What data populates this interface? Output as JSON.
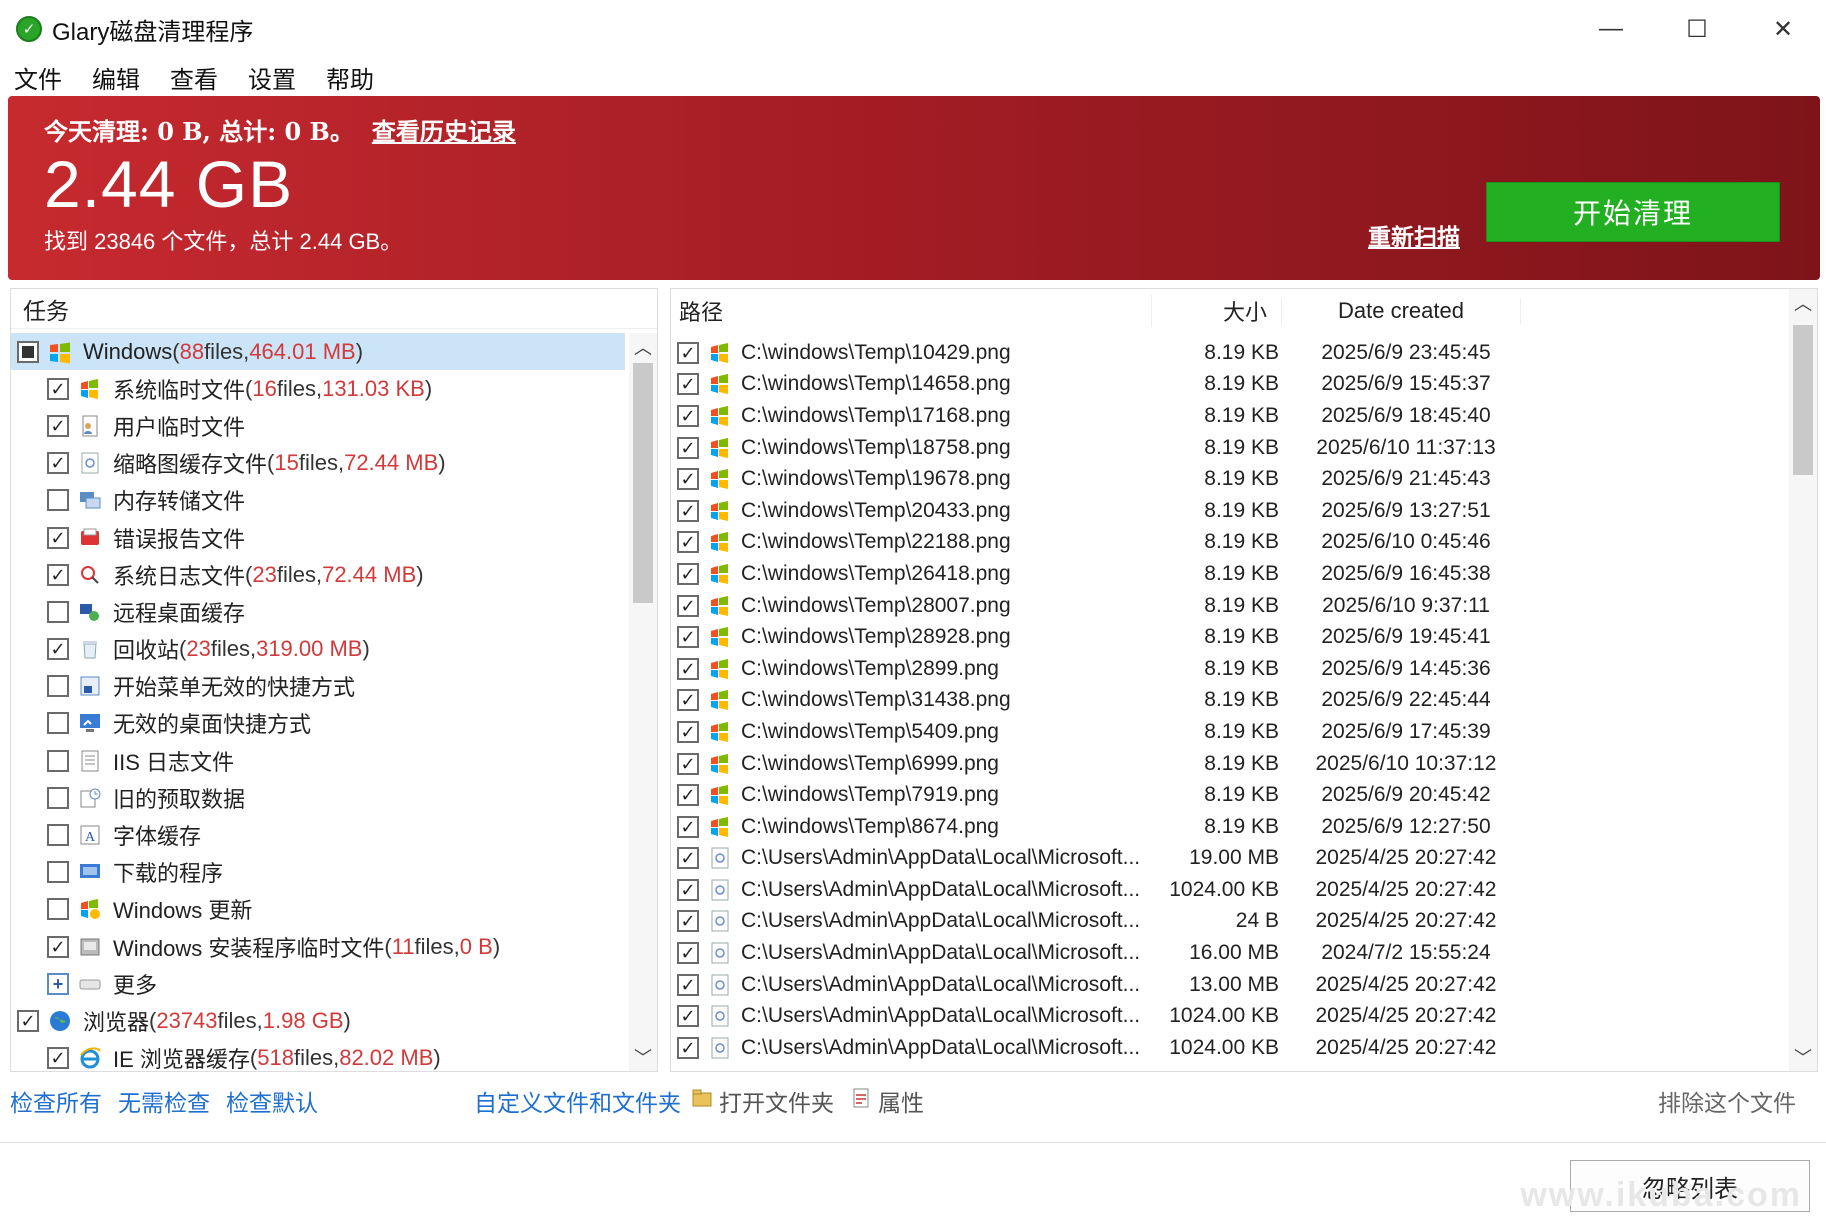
{
  "window": {
    "title": "Glary磁盘清理程序",
    "minimize": "—",
    "maximize": "☐",
    "close": "✕"
  },
  "menu": [
    "文件",
    "编辑",
    "查看",
    "设置",
    "帮助"
  ],
  "banner": {
    "summary": "今天清理: 0 B, 总计: 0 B。",
    "history_link": "查看历史记录",
    "total_size": "2.44 GB",
    "found_text": "找到 23846 个文件，总计 2.44 GB。",
    "rescan": "重新扫描",
    "start_button": "开始清理"
  },
  "left_panel": {
    "header": "任务",
    "tasks": [
      {
        "label": "Windows",
        "open": " (",
        "count": "88",
        "mid": " files, ",
        "size": "464.01 MB",
        "close": ")",
        "check": "partial",
        "level": 0,
        "icon": "windows-icon",
        "selected": true
      },
      {
        "label": "系统临时文件",
        "open": " (",
        "count": "16",
        "mid": " files, ",
        "size": "131.03 KB",
        "close": ")",
        "check": "checked",
        "level": 1,
        "icon": "windows-flag-icon"
      },
      {
        "label": "用户临时文件",
        "open": "",
        "count": "",
        "mid": "",
        "size": "",
        "close": "",
        "check": "checked",
        "level": 1,
        "icon": "user-temp-icon"
      },
      {
        "label": "缩略图缓存文件",
        "open": " (",
        "count": "15",
        "mid": " files, ",
        "size": "72.44 MB",
        "close": ")",
        "check": "checked",
        "level": 1,
        "icon": "thumbnail-icon"
      },
      {
        "label": "内存转储文件",
        "open": "",
        "count": "",
        "mid": "",
        "size": "",
        "close": "",
        "check": "unchecked",
        "level": 1,
        "icon": "memory-dump-icon"
      },
      {
        "label": "错误报告文件",
        "open": "",
        "count": "",
        "mid": "",
        "size": "",
        "close": "",
        "check": "checked",
        "level": 1,
        "icon": "error-report-icon"
      },
      {
        "label": "系统日志文件",
        "open": " (",
        "count": "23",
        "mid": " files, ",
        "size": "72.44 MB",
        "close": ")",
        "check": "checked",
        "level": 1,
        "icon": "system-log-icon"
      },
      {
        "label": "远程桌面缓存",
        "open": "",
        "count": "",
        "mid": "",
        "size": "",
        "close": "",
        "check": "unchecked",
        "level": 1,
        "icon": "remote-desktop-icon"
      },
      {
        "label": "回收站",
        "open": " (",
        "count": "23",
        "mid": " files, ",
        "size": "319.00 MB",
        "close": ")",
        "check": "checked",
        "level": 1,
        "icon": "recycle-bin-icon"
      },
      {
        "label": "开始菜单无效的快捷方式",
        "open": "",
        "count": "",
        "mid": "",
        "size": "",
        "close": "",
        "check": "unchecked",
        "level": 1,
        "icon": "start-menu-shortcut-icon"
      },
      {
        "label": "无效的桌面快捷方式",
        "open": "",
        "count": "",
        "mid": "",
        "size": "",
        "close": "",
        "check": "unchecked",
        "level": 1,
        "icon": "desktop-shortcut-icon"
      },
      {
        "label": "IIS 日志文件",
        "open": "",
        "count": "",
        "mid": "",
        "size": "",
        "close": "",
        "check": "unchecked",
        "level": 1,
        "icon": "iis-log-icon"
      },
      {
        "label": "旧的预取数据",
        "open": "",
        "count": "",
        "mid": "",
        "size": "",
        "close": "",
        "check": "unchecked",
        "level": 1,
        "icon": "prefetch-icon"
      },
      {
        "label": "字体缓存",
        "open": "",
        "count": "",
        "mid": "",
        "size": "",
        "close": "",
        "check": "unchecked",
        "level": 1,
        "icon": "font-cache-icon"
      },
      {
        "label": "下载的程序",
        "open": "",
        "count": "",
        "mid": "",
        "size": "",
        "close": "",
        "check": "unchecked",
        "level": 1,
        "icon": "downloaded-program-icon"
      },
      {
        "label": "Windows 更新",
        "open": "",
        "count": "",
        "mid": "",
        "size": "",
        "close": "",
        "check": "unchecked",
        "level": 1,
        "icon": "windows-update-icon"
      },
      {
        "label": "Windows 安装程序临时文件",
        "open": " (",
        "count": "11",
        "mid": " files, ",
        "size": "0 B",
        "close": ")",
        "check": "checked",
        "level": 1,
        "icon": "installer-temp-icon"
      },
      {
        "label": "更多",
        "open": "",
        "count": "",
        "mid": "",
        "size": "",
        "close": "",
        "check": "expand",
        "level": 1,
        "icon": "more-drive-icon"
      },
      {
        "label": "浏览器",
        "open": " (",
        "count": "23743",
        "mid": " files, ",
        "size": "1.98 GB",
        "close": ")",
        "check": "checked",
        "level": 0,
        "icon": "globe-icon"
      },
      {
        "label": "IE 浏览器缓存",
        "open": " (",
        "count": "518",
        "mid": " files, ",
        "size": "82.02 MB",
        "close": ")",
        "check": "checked",
        "level": 1,
        "icon": "ie-icon"
      }
    ]
  },
  "right_panel": {
    "columns": {
      "path": "路径",
      "size": "大小",
      "date": "Date created"
    },
    "files": [
      {
        "path": "C:\\windows\\Temp\\10429.png",
        "size": "8.19 KB",
        "date": "2025/6/9 23:45:45",
        "icon": "windows-flag-icon"
      },
      {
        "path": "C:\\windows\\Temp\\14658.png",
        "size": "8.19 KB",
        "date": "2025/6/9 15:45:37",
        "icon": "windows-flag-icon"
      },
      {
        "path": "C:\\windows\\Temp\\17168.png",
        "size": "8.19 KB",
        "date": "2025/6/9 18:45:40",
        "icon": "windows-flag-icon"
      },
      {
        "path": "C:\\windows\\Temp\\18758.png",
        "size": "8.19 KB",
        "date": "2025/6/10 11:37:13",
        "icon": "windows-flag-icon"
      },
      {
        "path": "C:\\windows\\Temp\\19678.png",
        "size": "8.19 KB",
        "date": "2025/6/9 21:45:43",
        "icon": "windows-flag-icon"
      },
      {
        "path": "C:\\windows\\Temp\\20433.png",
        "size": "8.19 KB",
        "date": "2025/6/9 13:27:51",
        "icon": "windows-flag-icon"
      },
      {
        "path": "C:\\windows\\Temp\\22188.png",
        "size": "8.19 KB",
        "date": "2025/6/10 0:45:46",
        "icon": "windows-flag-icon"
      },
      {
        "path": "C:\\windows\\Temp\\26418.png",
        "size": "8.19 KB",
        "date": "2025/6/9 16:45:38",
        "icon": "windows-flag-icon"
      },
      {
        "path": "C:\\windows\\Temp\\28007.png",
        "size": "8.19 KB",
        "date": "2025/6/10 9:37:11",
        "icon": "windows-flag-icon"
      },
      {
        "path": "C:\\windows\\Temp\\28928.png",
        "size": "8.19 KB",
        "date": "2025/6/9 19:45:41",
        "icon": "windows-flag-icon"
      },
      {
        "path": "C:\\windows\\Temp\\2899.png",
        "size": "8.19 KB",
        "date": "2025/6/9 14:45:36",
        "icon": "windows-flag-icon"
      },
      {
        "path": "C:\\windows\\Temp\\31438.png",
        "size": "8.19 KB",
        "date": "2025/6/9 22:45:44",
        "icon": "windows-flag-icon"
      },
      {
        "path": "C:\\windows\\Temp\\5409.png",
        "size": "8.19 KB",
        "date": "2025/6/9 17:45:39",
        "icon": "windows-flag-icon"
      },
      {
        "path": "C:\\windows\\Temp\\6999.png",
        "size": "8.19 KB",
        "date": "2025/6/10 10:37:12",
        "icon": "windows-flag-icon"
      },
      {
        "path": "C:\\windows\\Temp\\7919.png",
        "size": "8.19 KB",
        "date": "2025/6/9 20:45:42",
        "icon": "windows-flag-icon"
      },
      {
        "path": "C:\\windows\\Temp\\8674.png",
        "size": "8.19 KB",
        "date": "2025/6/9 12:27:50",
        "icon": "windows-flag-icon"
      },
      {
        "path": "C:\\Users\\Admin\\AppData\\Local\\Microsoft...",
        "size": "19.00 MB",
        "date": "2025/4/25 20:27:42",
        "icon": "thumbnail-icon"
      },
      {
        "path": "C:\\Users\\Admin\\AppData\\Local\\Microsoft...",
        "size": "1024.00 KB",
        "date": "2025/4/25 20:27:42",
        "icon": "thumbnail-icon"
      },
      {
        "path": "C:\\Users\\Admin\\AppData\\Local\\Microsoft...",
        "size": "24 B",
        "date": "2025/4/25 20:27:42",
        "icon": "thumbnail-icon"
      },
      {
        "path": "C:\\Users\\Admin\\AppData\\Local\\Microsoft...",
        "size": "16.00 MB",
        "date": "2024/7/2 15:55:24",
        "icon": "thumbnail-icon"
      },
      {
        "path": "C:\\Users\\Admin\\AppData\\Local\\Microsoft...",
        "size": "13.00 MB",
        "date": "2025/4/25 20:27:42",
        "icon": "thumbnail-icon"
      },
      {
        "path": "C:\\Users\\Admin\\AppData\\Local\\Microsoft...",
        "size": "1024.00 KB",
        "date": "2025/4/25 20:27:42",
        "icon": "thumbnail-icon"
      },
      {
        "path": "C:\\Users\\Admin\\AppData\\Local\\Microsoft...",
        "size": "1024.00 KB",
        "date": "2025/4/25 20:27:42",
        "icon": "thumbnail-icon"
      }
    ]
  },
  "bottom": {
    "check_all": "检查所有",
    "check_none": "无需检查",
    "check_default": "检查默认",
    "custom": "自定义文件和文件夹",
    "open_folder": "打开文件夹",
    "properties": "属性",
    "exclude": "排除这个文件",
    "ignore_list": "忽略列表"
  },
  "watermark": "www.ikuba.com",
  "colors": {
    "banner": "#b3222a",
    "start_button": "#22b022",
    "link": "#1f6fd0",
    "highlight_number": "#d23a3a"
  }
}
